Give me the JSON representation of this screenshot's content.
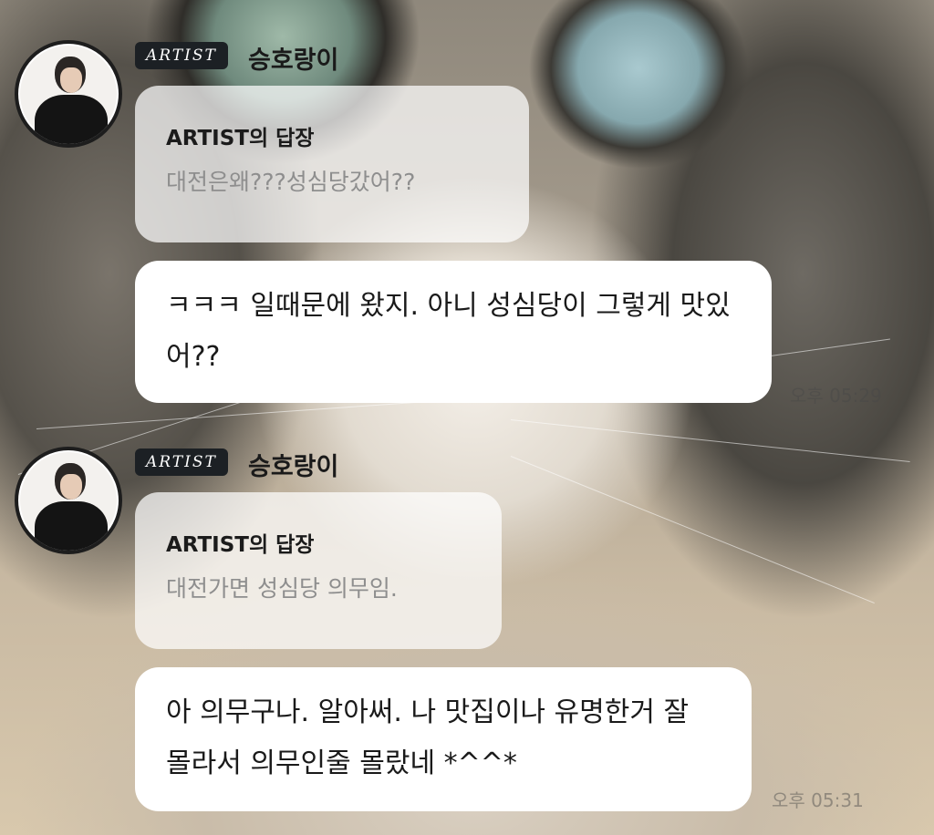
{
  "messages": [
    {
      "badge": "ARTIST",
      "name": "승호랑이",
      "reply_title": "ARTIST의 답장",
      "reply_text": "대전은왜???성심당갔어??",
      "message": "ㅋㅋㅋ 일때문에 왔지. 아니 성심당이 그렇게 맛있어??",
      "time": "오후 05:29"
    },
    {
      "badge": "ARTIST",
      "name": "승호랑이",
      "reply_title": "ARTIST의 답장",
      "reply_text": "대전가면 성심당 의무임.",
      "message": "아 의무구나. 알아써. 나 맛집이나 유명한거 잘 몰라서 의무인줄 몰랐네 *^^*",
      "time": "오후 05:31"
    }
  ]
}
